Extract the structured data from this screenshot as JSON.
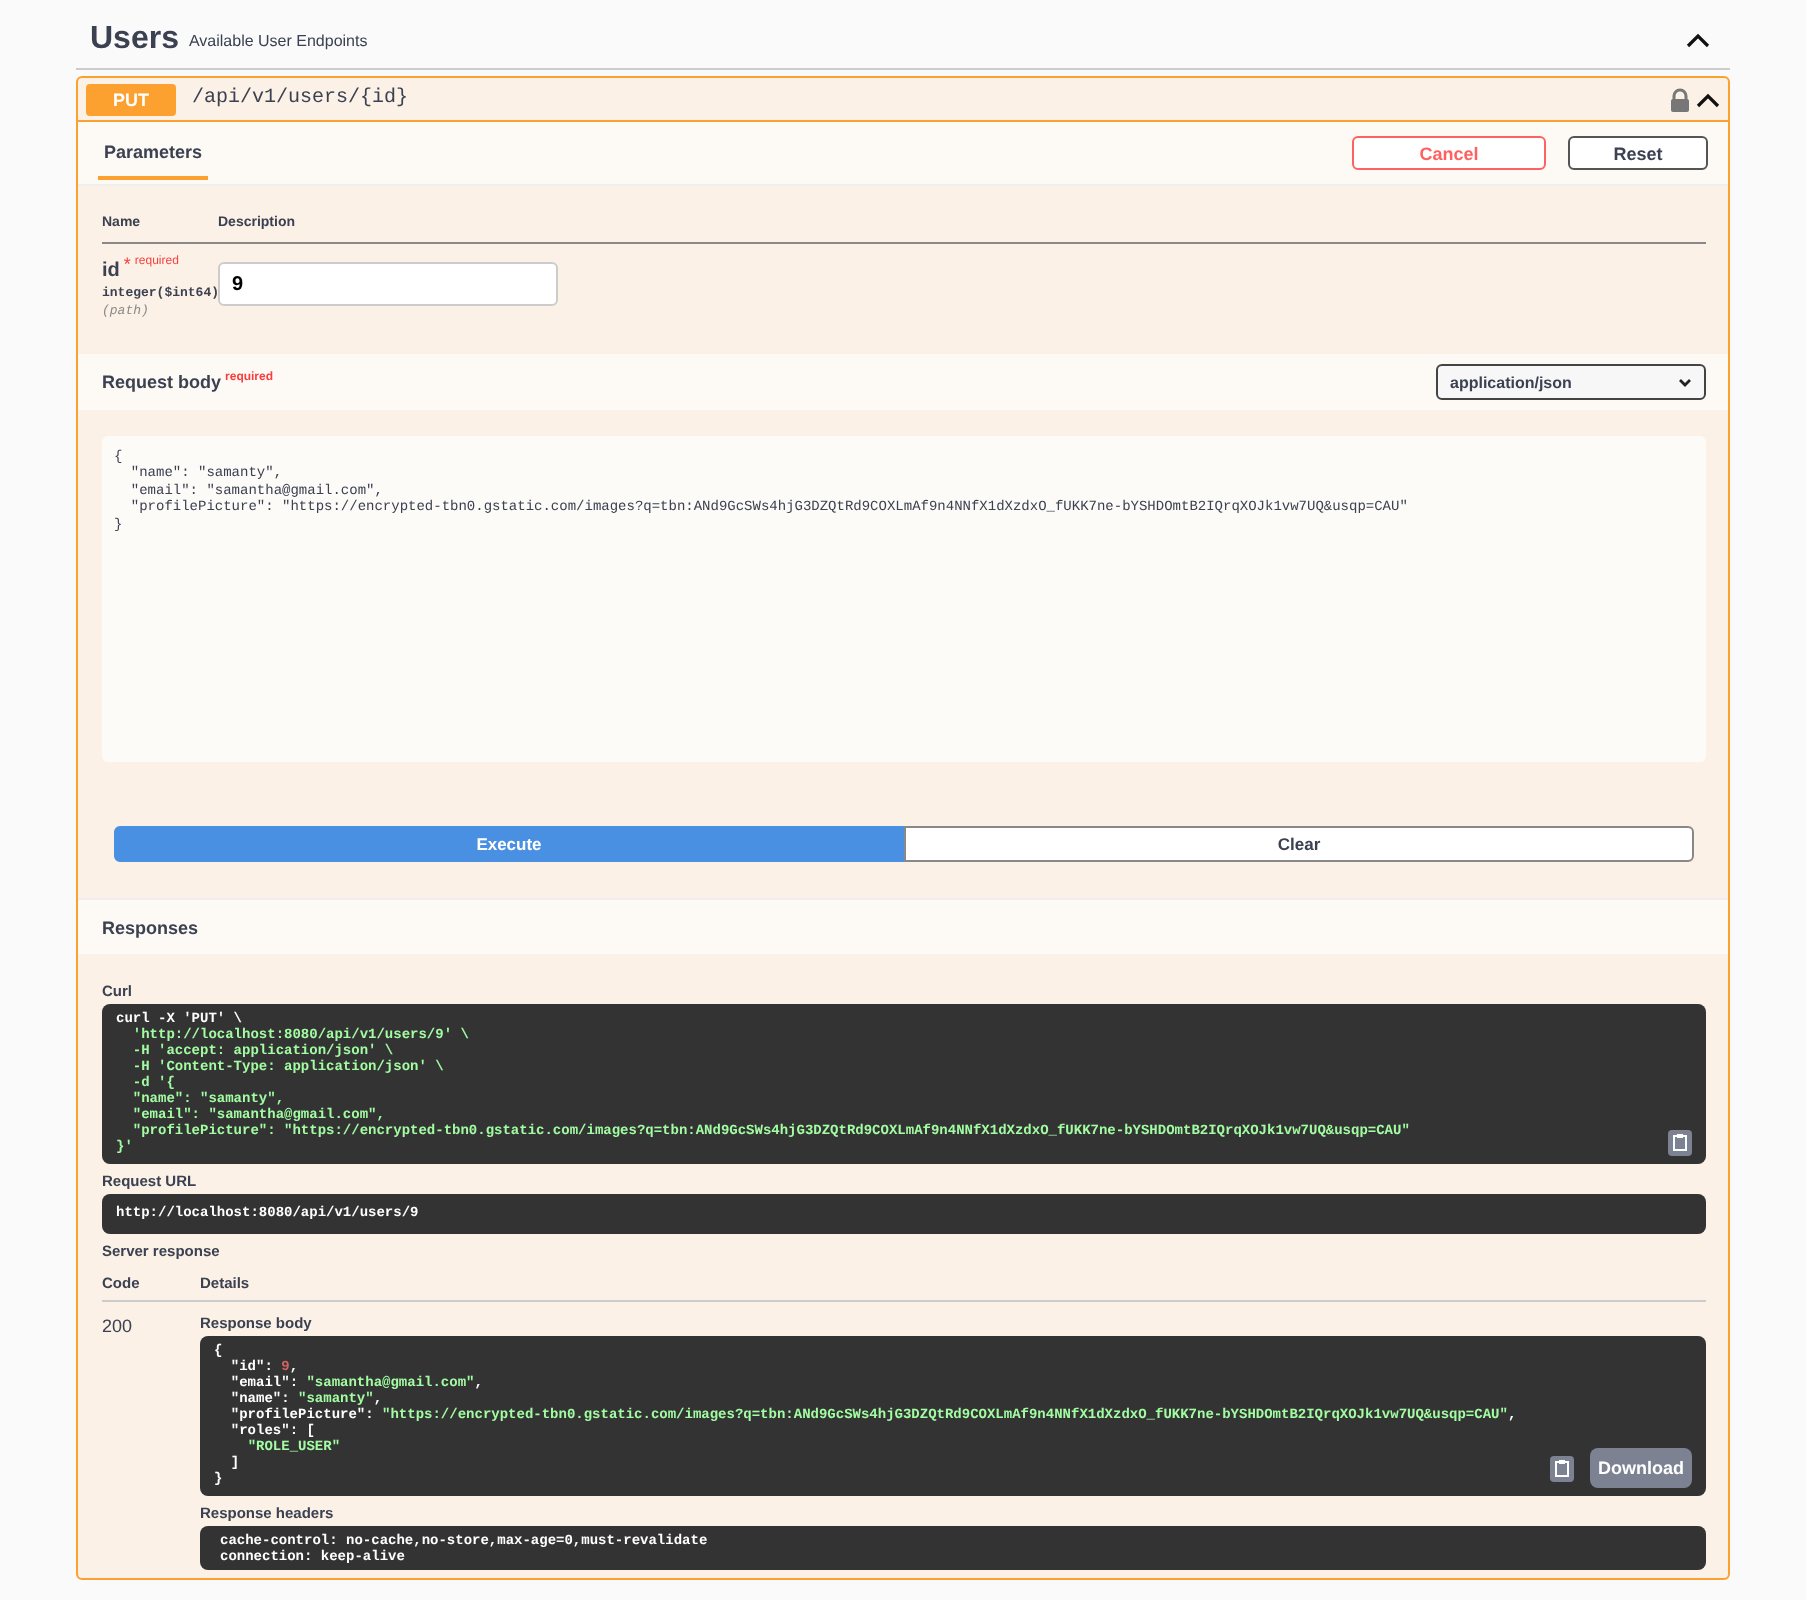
{
  "section": {
    "title": "Users",
    "description": "Available User Endpoints",
    "expanded": true
  },
  "operation": {
    "method": "PUT",
    "path": "/api/v1/users/{id}",
    "locked": true,
    "expanded": true
  },
  "tabs": [
    {
      "label": "Parameters",
      "selected": true
    }
  ],
  "buttons": {
    "cancel": "Cancel",
    "reset": "Reset"
  },
  "parameters": {
    "columns": [
      "Name",
      "Description"
    ],
    "rows": [
      {
        "name": "id",
        "required_mark": "*",
        "required_label": "required",
        "type": "integer($int64)",
        "location": "(path)",
        "value": "9"
      }
    ]
  },
  "request_body": {
    "title": "Request body",
    "required_label": "required",
    "content_type": "application/json",
    "lines": [
      "{",
      "  \"name\": \"samanty\",",
      "  \"email\": \"samantha@gmail.com\",",
      "  \"profilePicture\": \"https://encrypted-tbn0.gstatic.com/images?q=tbn:ANd9GcSWs4hjG3DZQtRd9COXLmAf9n4NNfX1dXzdxO_fUKK7ne-bYSHDOmtB2IQrqXOJk1vw7UQ&usqp=CAU\"",
      "}"
    ]
  },
  "actions": [
    {
      "label": "Execute",
      "kind": "primary"
    },
    {
      "label": "Clear",
      "kind": "secondary"
    }
  ],
  "responses": {
    "title": "Responses",
    "curl_label": "Curl",
    "curl_lines": [
      "curl -X 'PUT' \\",
      "  'http://localhost:8080/api/v1/users/9' \\",
      "  -H 'accept: application/json' \\",
      "  -H 'Content-Type: application/json' \\",
      "  -d '{",
      "  \"name\": \"samanty\",",
      "  \"email\": \"samantha@gmail.com\",",
      "  \"profilePicture\": \"https://encrypted-tbn0.gstatic.com/images?q=tbn:ANd9GcSWs4hjG3DZQtRd9COXLmAf9n4NNfX1dXzdxO_fUKK7ne-bYSHDOmtB2IQrqXOJk1vw7UQ&usqp=CAU\"",
      "}'"
    ],
    "request_url_label": "Request URL",
    "request_url": "http://localhost:8080/api/v1/users/9",
    "server_response_label": "Server response",
    "columns": [
      "Code",
      "Details"
    ],
    "code": "200",
    "body_label": "Response body",
    "body_lines": [
      "{",
      "  \"id\": 9,",
      "  \"email\": \"samantha@gmail.com\",",
      "  \"name\": \"samanty\",",
      "  \"profilePicture\": \"https://encrypted-tbn0.gstatic.com/images?q=tbn:ANd9GcSWs4hjG3DZQtRd9COXLmAf9n4NNfX1dXzdxO_fUKK7ne-bYSHDOmtB2IQrqXOJk1vw7UQ&usqp=CAU\",",
      "  \"roles\": [",
      "    \"ROLE_USER\"",
      "  ]",
      "}"
    ],
    "download": "Download",
    "headers_label": "Response headers",
    "header_lines": [
      "cache-control: no-cache,no-store,max-age=0,must-revalidate",
      "connection: keep-alive"
    ]
  }
}
